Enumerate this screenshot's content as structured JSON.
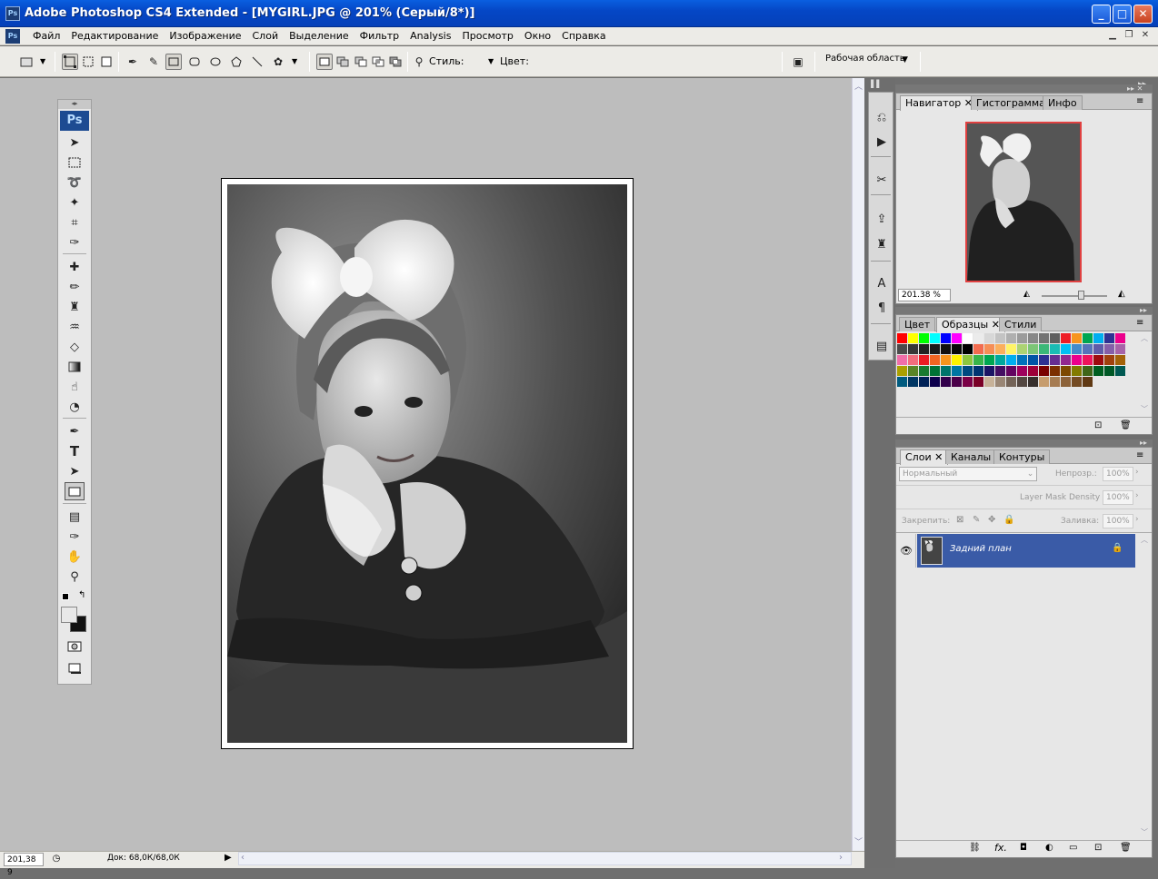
{
  "window": {
    "title": "Adobe Photoshop CS4 Extended - [MYGIRL.JPG @ 201% (Серый/8*)]",
    "app_icon": "Ps",
    "controls": [
      "minimize",
      "maximize",
      "close"
    ]
  },
  "menu": {
    "items": [
      "Файл",
      "Редактирование",
      "Изображение",
      "Слой",
      "Выделение",
      "Фильтр",
      "Analysis",
      "Просмотр",
      "Окно",
      "Справка"
    ]
  },
  "options": {
    "style_label": "Стиль:",
    "color_label": "Цвет:",
    "workspace_label": "Рабочая область"
  },
  "toolbox": {
    "logo": "Ps"
  },
  "navigator": {
    "tabs": [
      "Навигатор",
      "Гистограмма",
      "Инфо"
    ],
    "zoom_value": "201.38 %"
  },
  "swatches": {
    "tabs": [
      "Цвет",
      "Образцы",
      "Стили"
    ],
    "colors": [
      "#ff0000",
      "#ffff00",
      "#00ff00",
      "#00ffff",
      "#0000ff",
      "#ff00ff",
      "#ffffff",
      "#ebebeb",
      "#d7d7d7",
      "#c3c3c3",
      "#afafaf",
      "#9b9b9b",
      "#878787",
      "#737373",
      "#5f5f5f",
      "#ee1c24",
      "#f7941d",
      "#00a651",
      "#00aeef",
      "#2e3192",
      "#ec008c",
      "#4b4b4b",
      "#373737",
      "#232323",
      "#1a1a1a",
      "#101010",
      "#080808",
      "#000000",
      "#f26c4f",
      "#f68e56",
      "#fbaf5c",
      "#fff467",
      "#acd373",
      "#7cc576",
      "#3bb878",
      "#1abbb4",
      "#00bff3",
      "#438ccb",
      "#5674b9",
      "#605ca8",
      "#855fa8",
      "#a763a8",
      "#f06ea9",
      "#f26d7d",
      "#ed1c24",
      "#f26522",
      "#f7941d",
      "#fff200",
      "#8dc63f",
      "#39b54a",
      "#00a651",
      "#00a99d",
      "#00aeef",
      "#0072bc",
      "#0054a6",
      "#2e3192",
      "#662d91",
      "#92278f",
      "#ec008c",
      "#ed145b",
      "#9e0b0f",
      "#a0410d",
      "#a36209",
      "#aba000",
      "#598527",
      "#197b30",
      "#007236",
      "#00746b",
      "#0076a3",
      "#004a80",
      "#003471",
      "#1b1464",
      "#440e62",
      "#630460",
      "#9e005d",
      "#9e0039",
      "#790000",
      "#7b2e00",
      "#7d4900",
      "#827b00",
      "#406618",
      "#005e20",
      "#005826",
      "#005952",
      "#005b7f",
      "#003663",
      "#002157",
      "#0d004c",
      "#32004b",
      "#4b0049",
      "#7b0046",
      "#7a0026",
      "#c7b299",
      "#998675",
      "#736357",
      "#534741",
      "#37302d",
      "#c69c6d",
      "#a67c52",
      "#8c6239",
      "#754c24",
      "#603913"
    ],
    "color_count": 100
  },
  "layers": {
    "tabs": [
      "Слои",
      "Каналы",
      "Контуры"
    ],
    "blend_mode": "Нормальный",
    "opacity_label": "Непрозр.:",
    "opacity_value": "100%",
    "mask_density_label": "Layer Mask Density",
    "mask_density_value": "100%",
    "lock_label": "Закрепить:",
    "fill_label": "Заливка:",
    "fill_value": "100%",
    "layer_name": "Задний план",
    "highlight_color": "#3a5ba7"
  },
  "status": {
    "zoom": "201,38 9",
    "doc_info": "Док: 68,0К/68,0К"
  }
}
